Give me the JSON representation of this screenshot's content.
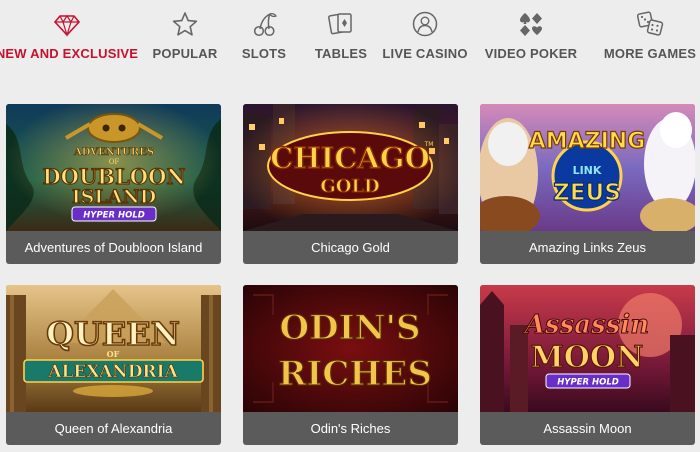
{
  "nav": {
    "items": [
      {
        "label": "NEW AND EXCLUSIVE",
        "icon": "diamond-icon",
        "active": true
      },
      {
        "label": "POPULAR",
        "icon": "star-icon",
        "active": false
      },
      {
        "label": "SLOTS",
        "icon": "cherries-icon",
        "active": false
      },
      {
        "label": "TABLES",
        "icon": "playing-cards-icon",
        "active": false
      },
      {
        "label": "LIVE CASINO",
        "icon": "dealer-icon",
        "active": false
      },
      {
        "label": "VIDEO POKER",
        "icon": "card-suits-icon",
        "active": false
      },
      {
        "label": "MORE GAMES",
        "icon": "dice-icon",
        "active": false
      }
    ]
  },
  "colors": {
    "accent": "#c8102e",
    "nav_text": "#555555",
    "background": "#ededed",
    "card_label_bg": "#5b5b5b"
  },
  "games": [
    {
      "title": "Adventures of Doubloon Island",
      "art": {
        "line1": "ADVENTURES",
        "line2": "OF",
        "line3": "DOUBLOON",
        "line4": "ISLAND",
        "badge": "HYPER HOLD"
      }
    },
    {
      "title": "Chicago Gold",
      "art": {
        "line1": "CHICAGO",
        "line2": "GOLD",
        "mark": "TM"
      }
    },
    {
      "title": "Amazing Links Zeus",
      "art": {
        "line1": "AMAZING",
        "line2": "LINK",
        "line3": "ZEUS"
      }
    },
    {
      "title": "Queen of Alexandria",
      "art": {
        "line1": "QUEEN",
        "line2": "OF",
        "line3": "ALEXANDRIA"
      }
    },
    {
      "title": "Odin's Riches",
      "art": {
        "line1": "ODIN'S",
        "line2": "RICHES"
      }
    },
    {
      "title": "Assassin Moon",
      "art": {
        "line1": "Assassin",
        "line2": "MOON",
        "badge": "HYPER HOLD"
      }
    }
  ]
}
